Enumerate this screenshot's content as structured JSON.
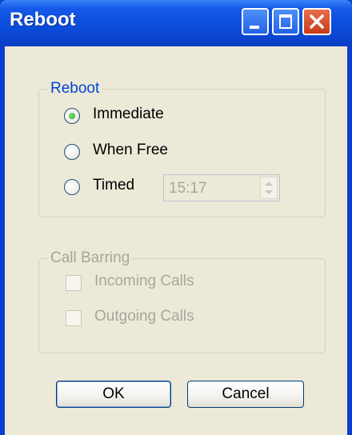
{
  "window": {
    "title": "Reboot",
    "controls": [
      "minimize-icon",
      "maximize-icon",
      "close-icon"
    ]
  },
  "reboot_group": {
    "legend": "Reboot",
    "options": [
      {
        "label": "Immediate",
        "selected": true
      },
      {
        "label": "When Free",
        "selected": false
      },
      {
        "label": "Timed",
        "selected": false
      }
    ],
    "timed_value": "15:17",
    "timed_enabled": false
  },
  "call_barring_group": {
    "legend": "Call Barring",
    "enabled": false,
    "options": [
      {
        "label": "Incoming Calls",
        "checked": false
      },
      {
        "label": "Outgoing Calls",
        "checked": false
      }
    ]
  },
  "buttons": {
    "ok": "OK",
    "cancel": "Cancel"
  },
  "colors": {
    "titlebar": "#0b4ddb",
    "dialog_bg": "#ece9d8",
    "group_legend": "#0046d5",
    "disabled_text": "#a7a69a"
  }
}
